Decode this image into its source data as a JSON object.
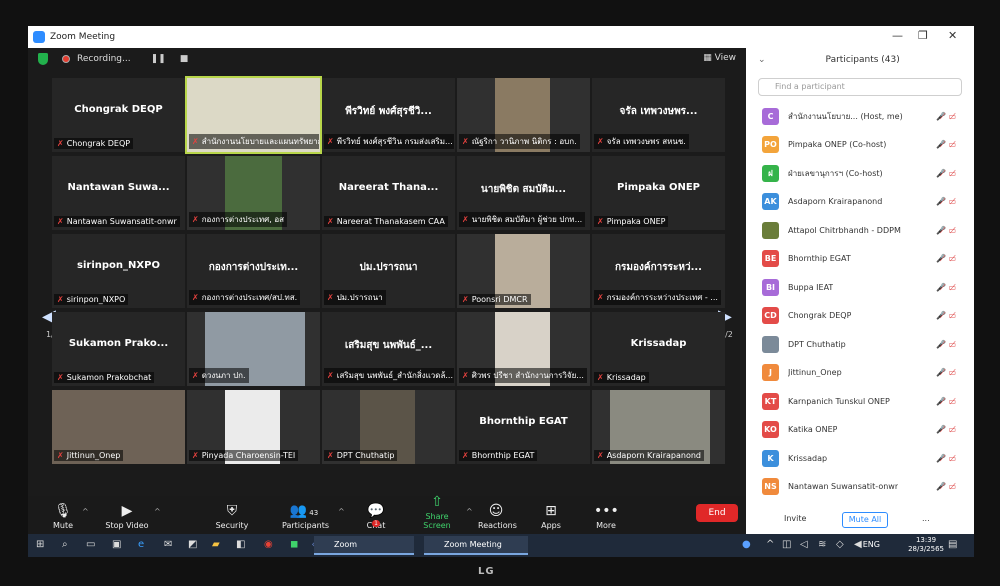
{
  "window": {
    "title": "Zoom Meeting"
  },
  "topbar": {
    "recording_label": "Recording...",
    "pause": "❚❚",
    "stop": "■",
    "view_label": "View"
  },
  "tiles": [
    {
      "big": "Chongrak DEQP",
      "name": "Chongrak DEQP"
    },
    {
      "big": "",
      "name": "สำนักงานนโยบายและแผนทรัพยากร..."
    },
    {
      "big": "พีรวิทย์ พงศ์สุรชีวิ...",
      "name": "พีรวิทย์ พงศ์สุรชีวิน กรมส่งเสริม..."
    },
    {
      "big": "",
      "name": "ณัฐริกา วานิภาพ นิติกร : อบก."
    },
    {
      "big": "จรัล เทพวงษพร...",
      "name": "จรัล เทพวงษพร สหนช."
    },
    {
      "big": "Nantawan Suwa...",
      "name": "Nantawan Suwansatit-onwr"
    },
    {
      "big": "",
      "name": "กองการต่างประเทศ, อส"
    },
    {
      "big": "Nareerat Thana...",
      "name": "Nareerat Thanakasem CAA"
    },
    {
      "big": "นายพิชิต สมบัติม...",
      "name": "นายพิชิต สมบัติมา ผู้ช่วย ปกท..."
    },
    {
      "big": "Pimpaka ONEP",
      "name": "Pimpaka ONEP"
    },
    {
      "big": "sirinpon_NXPO",
      "name": "sirinpon_NXPO"
    },
    {
      "big": "กองการต่างประเท...",
      "name": "กองการต่างประเทศ/สป.ทส."
    },
    {
      "big": "ปม.ปรารถนา",
      "name": "ปม.ปรารถนา"
    },
    {
      "big": "",
      "name": "Poonsri DMCR"
    },
    {
      "big": "กรมองค์การระหว่...",
      "name": "กรมองค์การระหว่างประเทศ - ..."
    },
    {
      "big": "Sukamon Prako...",
      "name": "Sukamon Prakobchat"
    },
    {
      "big": "",
      "name": "ดวงนภา ปก."
    },
    {
      "big": "เสริมสุข นพพันธ์_...",
      "name": "เสริมสุข นพพันธ์_สำนักสิ่งแวดล้..."
    },
    {
      "big": "",
      "name": "ศิวพร ปรีชา สำนักงานการวิจัย..."
    },
    {
      "big": "Krissadap",
      "name": "Krissadap"
    },
    {
      "big": "",
      "name": "Jittinun_Onep"
    },
    {
      "big": "",
      "name": "Pinyada Charoensin-TEI"
    },
    {
      "big": "",
      "name": "DPT Chuthatip"
    },
    {
      "big": "Bhornthip EGAT",
      "name": "Bhornthip EGAT"
    },
    {
      "big": "",
      "name": "Asdaporn Krairapanond"
    }
  ],
  "pager": {
    "left": "1/2",
    "right": "1/2"
  },
  "toolbar": {
    "mute": "Mute",
    "stop_video": "Stop Video",
    "security": "Security",
    "participants": "Participants",
    "participants_count": "43",
    "chat": "Chat",
    "chat_badge": "1",
    "share": "Share Screen",
    "reactions": "Reactions",
    "apps": "Apps",
    "more": "More",
    "end": "End"
  },
  "panel": {
    "title": "Participants (43)",
    "search_placeholder": "Find a participant",
    "invite": "Invite",
    "mute_all": "Mute All",
    "more": "...",
    "participants": [
      {
        "initials": "C",
        "color": "#a76bd8",
        "name": "สำนักงานนโยบาย... (Host, me)"
      },
      {
        "initials": "PO",
        "color": "#f3a43b",
        "name": "Pimpaka ONEP (Co-host)"
      },
      {
        "initials": "ฝ",
        "color": "#35b34a",
        "name": "ฝ่ายเลขานุการฯ (Co-host)"
      },
      {
        "initials": "AK",
        "color": "#3c8fdc",
        "name": "Asdaporn Krairapanond"
      },
      {
        "initials": "",
        "color": "#6a7d3a",
        "name": "Attapol Chitrbhandh - DDPM"
      },
      {
        "initials": "BE",
        "color": "#e34b48",
        "name": "Bhornthip EGAT"
      },
      {
        "initials": "BI",
        "color": "#a76bd8",
        "name": "Buppa IEAT"
      },
      {
        "initials": "CD",
        "color": "#e34b48",
        "name": "Chongrak DEQP"
      },
      {
        "initials": "",
        "color": "#7b8a99",
        "name": "DPT Chuthatip"
      },
      {
        "initials": "J",
        "color": "#f08a3c",
        "name": "Jittinun_Onep"
      },
      {
        "initials": "KT",
        "color": "#e34b48",
        "name": "Karnpanich Tunskul ONEP"
      },
      {
        "initials": "KO",
        "color": "#e34b48",
        "name": "Katika ONEP"
      },
      {
        "initials": "K",
        "color": "#3c8fdc",
        "name": "Krissadap"
      },
      {
        "initials": "NS",
        "color": "#f08a3c",
        "name": "Nantawan Suwansatit-onwr"
      }
    ]
  },
  "taskbar": {
    "task_zoom": "Zoom",
    "task_meeting": "Zoom Meeting",
    "lang": "ENG",
    "time": "13:39",
    "date": "28/3/2565"
  },
  "monitor_brand": "LG"
}
